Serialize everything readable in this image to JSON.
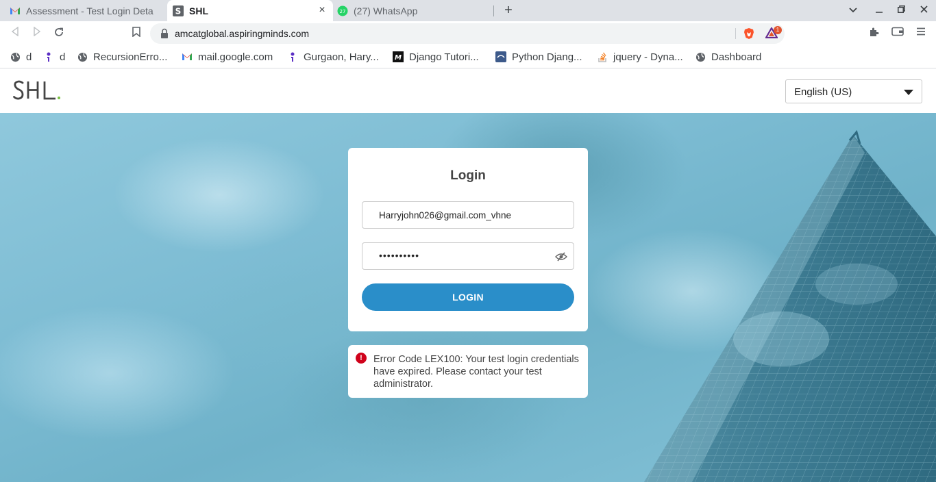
{
  "browser": {
    "tabs": [
      {
        "title": "Assessment - Test Login Deta",
        "icon": "gmail-icon",
        "active": false
      },
      {
        "title": "SHL",
        "icon": "shl-icon",
        "active": true
      },
      {
        "title": "(27) WhatsApp",
        "icon": "whatsapp-icon",
        "active": false,
        "badge": "27"
      }
    ],
    "url": "amcatglobal.aspiringminds.com",
    "rewards_badge": "1",
    "bookmarks": [
      {
        "label": "d",
        "icon": "globe-icon"
      },
      {
        "label": "d",
        "icon": "info-pin-icon"
      },
      {
        "label": "RecursionErro...",
        "icon": "globe-icon"
      },
      {
        "label": "mail.google.com",
        "icon": "gmail-icon"
      },
      {
        "label": "Gurgaon, Hary...",
        "icon": "info-pin-icon"
      },
      {
        "label": "Django Tutori...",
        "icon": "medium-icon"
      },
      {
        "label": "Python Djang...",
        "icon": "python-icon"
      },
      {
        "label": "jquery - Dyna...",
        "icon": "stackoverflow-icon"
      },
      {
        "label": "Dashboard",
        "icon": "globe-icon"
      }
    ]
  },
  "header": {
    "language": "English (US)"
  },
  "login": {
    "title": "Login",
    "email": "Harryjohn026@gmail.com_vhne",
    "password_masked": "••••••••••",
    "button": "LOGIN"
  },
  "error": {
    "message": "Error Code LEX100: Your test login credentials have expired. Please contact your test administrator."
  },
  "colors": {
    "primary_button": "#2a8ec9",
    "error_red": "#d0021b",
    "logo_dot": "#7ac143"
  }
}
